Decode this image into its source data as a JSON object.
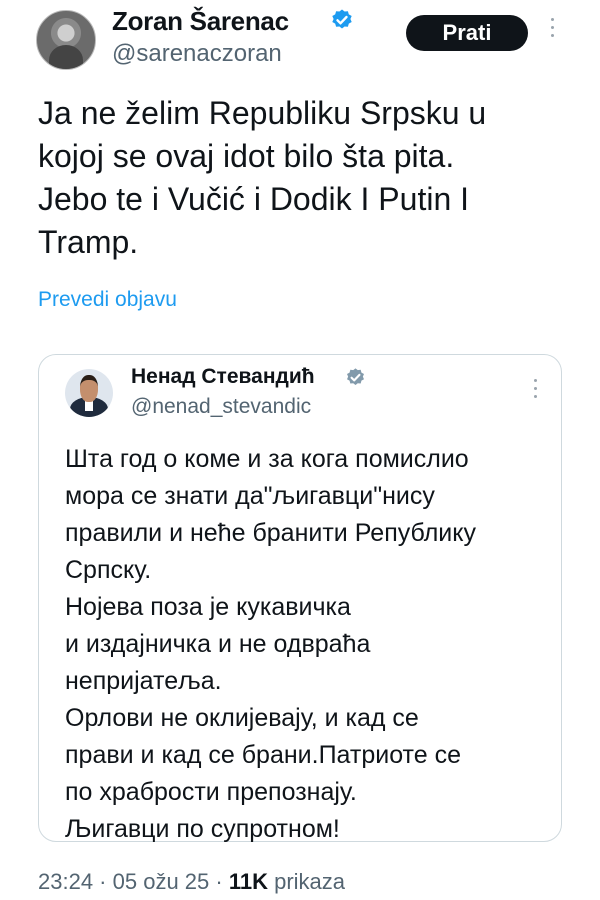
{
  "tweet": {
    "author_name": "Zoran Šarenac",
    "handle": "@sarenaczoran",
    "follow_label": "Prati",
    "text": "Ja ne želim Republiku Srpsku u\nkojoj se ovaj idot bilo šta pita.\nJebo te i Vučić i Dodik I Putin I\nTramp.",
    "translate_label": "Prevedi objavu"
  },
  "quoted": {
    "author_name": "Ненад Стевандић",
    "handle": "@nenad_stevandic",
    "text": "Шта год о коме и за кога помислио\nмора се знати да\"љигавци\"нису\nправили и неће бранити Републику\nСрпску.\nНојева поза је кукавичка\nи издајничка и не одвраћа\nнепријатеља.\nОрлови не оклијевају, и кад се\nправи и кад се брани.Патриоте се\nпо  храбрости препознају.\nЉигавци по супротном!"
  },
  "meta": {
    "time": "23:24",
    "separator": " · ",
    "date": "05 ožu 25",
    "views_count": "11K",
    "views_label": "prikaza"
  },
  "icons": {
    "verified": "verified-badge-icon",
    "more": "more-vertical-icon"
  },
  "colors": {
    "verified_blue": "#1d9bf0",
    "verified_gray": "#829aab",
    "link": "#1d9bf0"
  }
}
